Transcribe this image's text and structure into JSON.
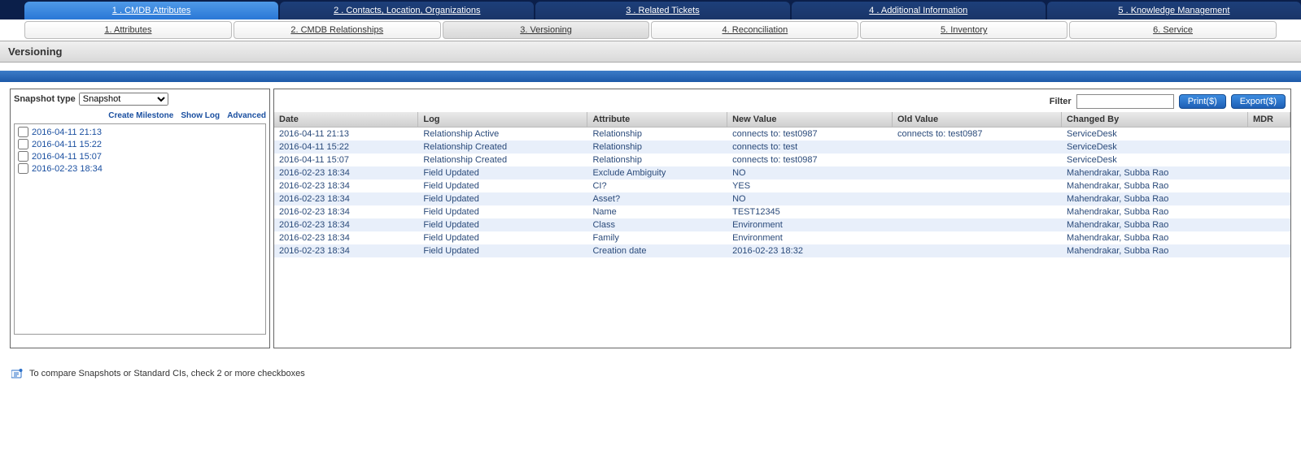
{
  "primary_tabs": [
    {
      "label": "1 . CMDB Attributes",
      "active": true
    },
    {
      "label": "2 . Contacts, Location, Organizations",
      "active": false
    },
    {
      "label": "3 . Related Tickets",
      "active": false
    },
    {
      "label": "4 . Additional Information",
      "active": false
    },
    {
      "label": "5 . Knowledge Management",
      "active": false
    }
  ],
  "secondary_tabs": [
    {
      "label": "1. Attributes",
      "active": false
    },
    {
      "label": "2. CMDB Relationships",
      "active": false
    },
    {
      "label": "3. Versioning",
      "active": true
    },
    {
      "label": "4. Reconciliation",
      "active": false
    },
    {
      "label": "5. Inventory",
      "active": false
    },
    {
      "label": "6. Service",
      "active": false
    }
  ],
  "page_title": "Versioning",
  "left": {
    "snapshot_type_label": "Snapshot type",
    "snapshot_type_value": "Snapshot",
    "actions": {
      "create_milestone": "Create Milestone",
      "show_log": "Show Log",
      "advanced": "Advanced"
    },
    "snapshots": [
      "2016-04-11 21:13",
      "2016-04-11 15:22",
      "2016-04-11 15:07",
      "2016-02-23 18:34"
    ]
  },
  "toolbar": {
    "filter_label": "Filter",
    "filter_value": "",
    "print_label": "Print($)",
    "export_label": "Export($)"
  },
  "grid": {
    "headers": {
      "date": "Date",
      "log": "Log",
      "attribute": "Attribute",
      "new_value": "New Value",
      "old_value": "Old Value",
      "changed_by": "Changed By",
      "mdr": "MDR"
    },
    "rows": [
      {
        "date": "2016-04-11 21:13",
        "log": "Relationship Active",
        "attribute": "Relationship",
        "new_value": "connects to: test0987",
        "old_value": "connects to: test0987",
        "changed_by": "ServiceDesk",
        "mdr": ""
      },
      {
        "date": "2016-04-11 15:22",
        "log": "Relationship Created",
        "attribute": "Relationship",
        "new_value": "connects to: test",
        "old_value": "",
        "changed_by": "ServiceDesk",
        "mdr": ""
      },
      {
        "date": "2016-04-11 15:07",
        "log": "Relationship Created",
        "attribute": "Relationship",
        "new_value": "connects to: test0987",
        "old_value": "",
        "changed_by": "ServiceDesk",
        "mdr": ""
      },
      {
        "date": "2016-02-23 18:34",
        "log": "Field Updated",
        "attribute": "Exclude Ambiguity",
        "new_value": "NO",
        "old_value": "",
        "changed_by": "Mahendrakar, Subba Rao",
        "mdr": ""
      },
      {
        "date": "2016-02-23 18:34",
        "log": "Field Updated",
        "attribute": "CI?",
        "new_value": "YES",
        "old_value": "",
        "changed_by": "Mahendrakar, Subba Rao",
        "mdr": ""
      },
      {
        "date": "2016-02-23 18:34",
        "log": "Field Updated",
        "attribute": "Asset?",
        "new_value": "NO",
        "old_value": "",
        "changed_by": "Mahendrakar, Subba Rao",
        "mdr": ""
      },
      {
        "date": "2016-02-23 18:34",
        "log": "Field Updated",
        "attribute": "Name",
        "new_value": "TEST12345",
        "old_value": "",
        "changed_by": "Mahendrakar, Subba Rao",
        "mdr": ""
      },
      {
        "date": "2016-02-23 18:34",
        "log": "Field Updated",
        "attribute": "Class",
        "new_value": "Environment",
        "old_value": "",
        "changed_by": "Mahendrakar, Subba Rao",
        "mdr": ""
      },
      {
        "date": "2016-02-23 18:34",
        "log": "Field Updated",
        "attribute": "Family",
        "new_value": "Environment",
        "old_value": "",
        "changed_by": "Mahendrakar, Subba Rao",
        "mdr": ""
      },
      {
        "date": "2016-02-23 18:34",
        "log": "Field Updated",
        "attribute": "Creation date",
        "new_value": "2016-02-23 18:32",
        "old_value": "",
        "changed_by": "Mahendrakar, Subba Rao",
        "mdr": ""
      }
    ]
  },
  "hint": "To compare Snapshots or Standard CIs, check 2 or more checkboxes"
}
